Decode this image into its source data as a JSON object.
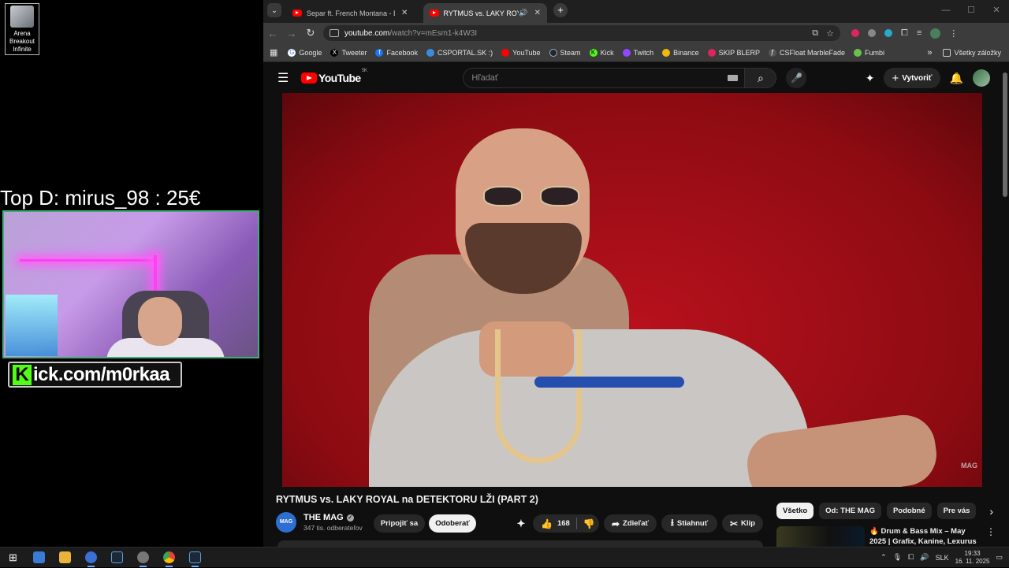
{
  "desktop": {
    "icon_label": "Arena Breakout Infinite",
    "donor_line": "Top D: mirus_98 : 25€",
    "kick_url": "Kick.com/m0rkaa",
    "kick_k": "K",
    "kick_rest": "ick.com/m0rkaa"
  },
  "browser": {
    "tabs": [
      {
        "title": "Separ ft. French Montana - Bo",
        "active": false
      },
      {
        "title": "RYTMUS vs. LAKY ROYAL n",
        "active": true
      }
    ],
    "url_domain": "youtube.com",
    "url_path": "/watch?v=mEsm1-k4W3I",
    "bookmarks": [
      {
        "label": "Google",
        "color": "#ffffff"
      },
      {
        "label": "Tweeter",
        "color": "#000000"
      },
      {
        "label": "Facebook",
        "color": "#1877f2"
      },
      {
        "label": "CSPORTAL.SK :)",
        "color": "#3a8dde"
      },
      {
        "label": "YouTube",
        "color": "#ff0000"
      },
      {
        "label": "Steam",
        "color": "#1b2838"
      },
      {
        "label": "Kick",
        "color": "#53fc18"
      },
      {
        "label": "Twitch",
        "color": "#9146ff"
      },
      {
        "label": "Binance",
        "color": "#f0b90b"
      },
      {
        "label": "SKIP BLERP",
        "color": "#e0245e"
      },
      {
        "label": "CSFloat MarbleFade",
        "color": "#555555"
      },
      {
        "label": "Fumbi",
        "color": "#6ac24a"
      }
    ],
    "all_bookmarks": "Všetky záložky"
  },
  "youtube": {
    "logo": "YouTube",
    "region": "SK",
    "search_placeholder": "Hľadať",
    "create_label": "Vytvoriť",
    "video_watermark": "MAG",
    "video_title": "RYTMUS vs. LAKY ROYAL na DETEKTORU LŽI (PART 2)",
    "channel": {
      "avatar_text": "MAG",
      "name": "THE MAG",
      "subscribers": "347 tis. odberateľov"
    },
    "join_label": "Pripojiť sa",
    "subscribe_label": "Odoberať",
    "like_count": "168",
    "share_label": "Zdieľať",
    "download_label": "Stiahnuť",
    "clip_label": "Klip",
    "chips": [
      "Všetko",
      "Od: THE MAG",
      "Podobné",
      "Pre vás"
    ],
    "rec_title": "🔥 Drum & Bass Mix – May 2025 | Grafix, Kanine, Lexurus"
  },
  "taskbar": {
    "time": "19:33",
    "date": "16. 11. 2025",
    "lang": "SLK"
  }
}
